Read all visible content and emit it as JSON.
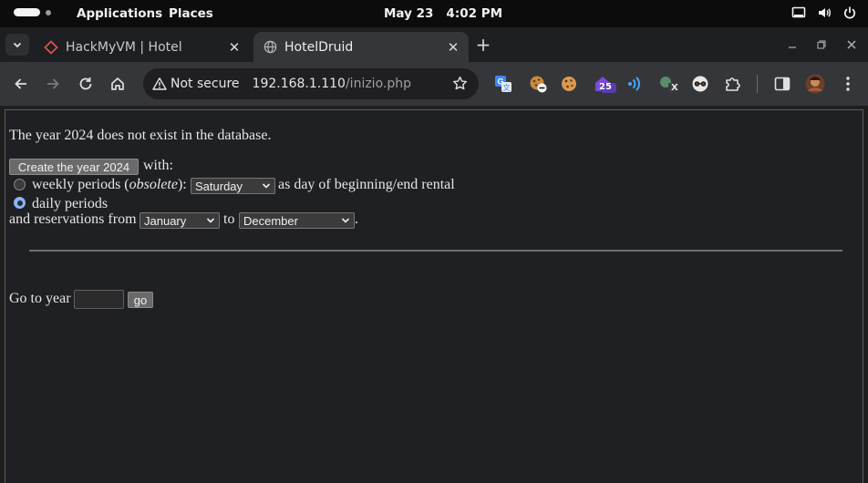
{
  "topbar": {
    "applications": "Applications",
    "places": "Places",
    "date": "May 23",
    "time": "4:02 PM"
  },
  "tabs": [
    {
      "title": "HackMyVM | Hotel",
      "favicon": "hackmyvm-diamond-icon"
    },
    {
      "title": "HotelDruid",
      "favicon": "globe-icon"
    }
  ],
  "toolbar": {
    "security_label": "Not secure",
    "url_host": "192.168.1.110",
    "url_path": "/inizio.php",
    "extensions": [
      "translate-icon",
      "cookie-block-icon",
      "cookie-icon",
      "house-badge-icon",
      "wifi-extension-icon",
      "proxy-x-icon",
      "spy-glasses-icon",
      "puzzle-icon"
    ],
    "ext_badge_count": "25",
    "ext_badge_x": "X"
  },
  "page": {
    "message": "The year 2024 does not exist in the database.",
    "create_button": "Create the year 2024",
    "with": "with:",
    "weekly_pre": "weekly periods (",
    "weekly_em": "obsolete",
    "weekly_post": "):",
    "weekday_selected": "Saturday",
    "weekday_suffix": "as day of beginning/end rental",
    "daily_label": "daily periods",
    "reservations_from": "and reservations from",
    "month_from": "January",
    "to": "to",
    "month_to": "December",
    "period": ".",
    "goto_label": "Go to year",
    "goto_value": "",
    "go_button": "go"
  },
  "colors": {
    "topbar_bg": "#0c0c0c",
    "tabstrip_bg": "#1e1f22",
    "toolbar_bg": "#35363a",
    "page_bg": "#1f2023",
    "radio_checked": "#8ab4f8"
  }
}
